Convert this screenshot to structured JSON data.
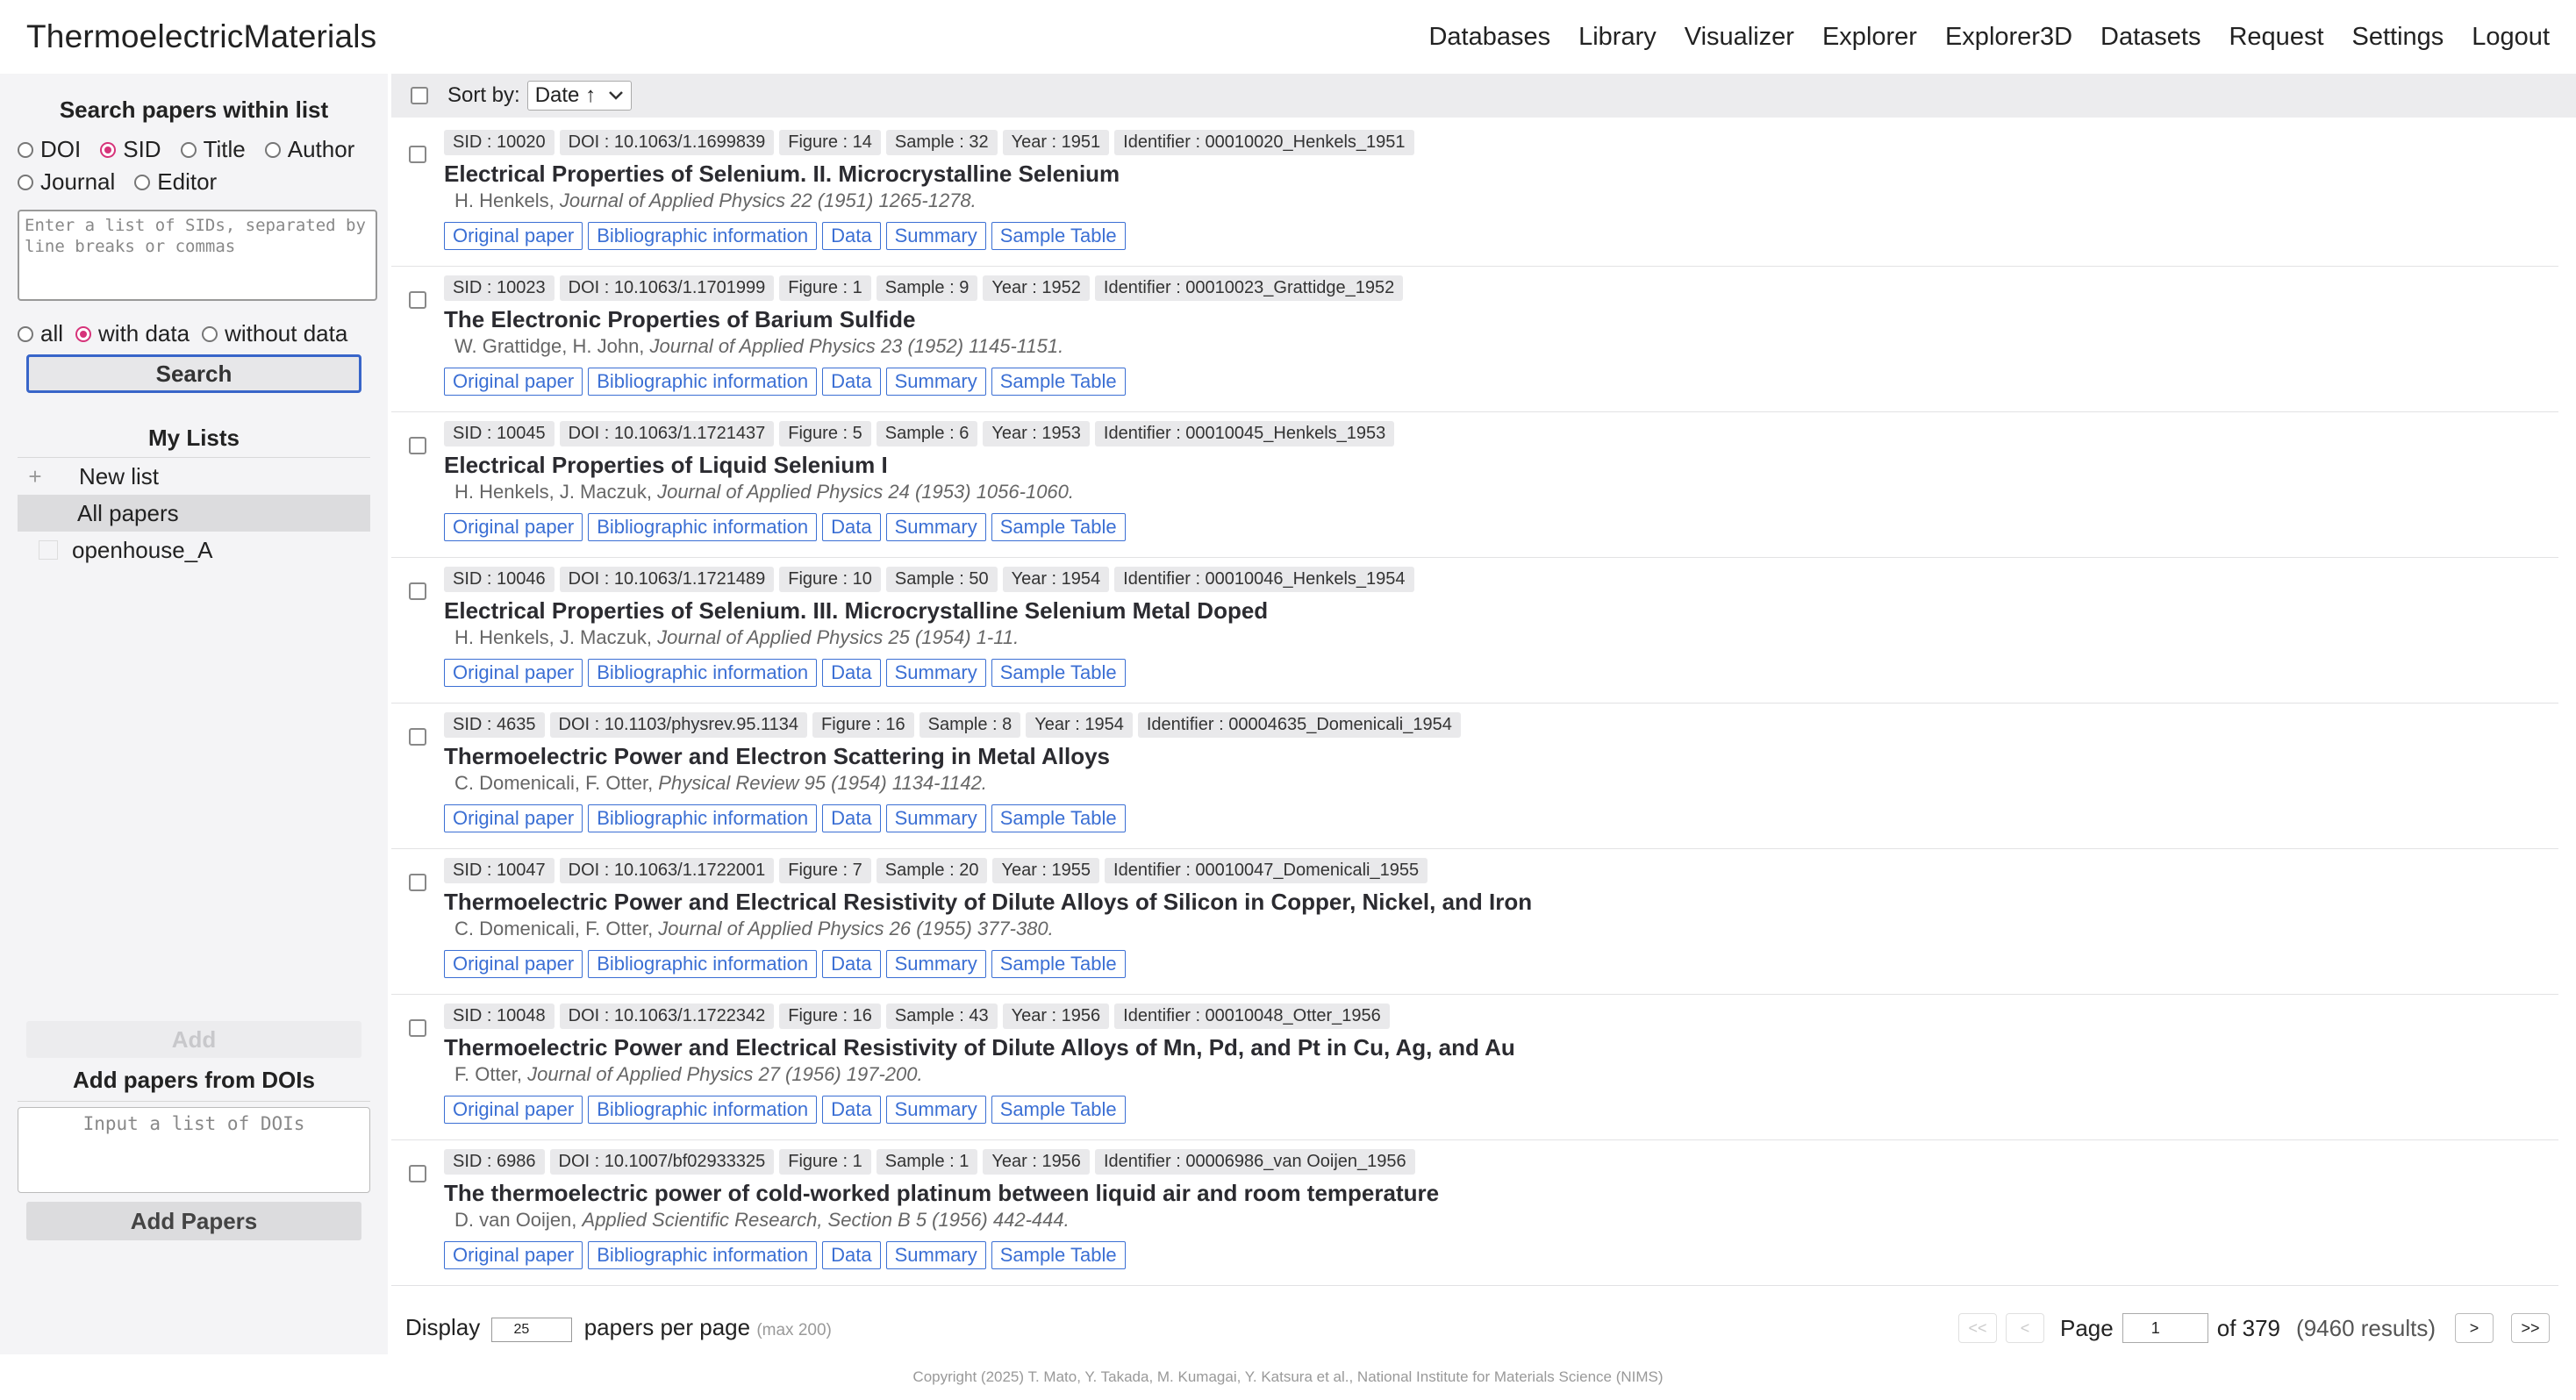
{
  "brand": "ThermoelectricMaterials",
  "nav": [
    "Databases",
    "Library",
    "Visualizer",
    "Explorer",
    "Explorer3D",
    "Datasets",
    "Request",
    "Settings",
    "Logout"
  ],
  "sidebar": {
    "search_heading": "Search papers within list",
    "search_by": [
      {
        "label": "DOI",
        "selected": false
      },
      {
        "label": "SID",
        "selected": true
      },
      {
        "label": "Title",
        "selected": false
      },
      {
        "label": "Author",
        "selected": false
      },
      {
        "label": "Journal",
        "selected": false
      },
      {
        "label": "Editor",
        "selected": false
      }
    ],
    "sid_placeholder": "Enter a list of SIDs, separated by line breaks or commas",
    "data_filter": [
      {
        "label": "all",
        "selected": false
      },
      {
        "label": "with data",
        "selected": true
      },
      {
        "label": "without data",
        "selected": false
      }
    ],
    "search_button": "Search",
    "my_lists_title": "My Lists",
    "new_list": "New list",
    "all_papers": "All papers",
    "lists": [
      "openhouse_A"
    ],
    "add_button": "Add",
    "add_dois_title": "Add papers from DOIs",
    "dois_placeholder": "Input a list of DOIs",
    "add_papers_button": "Add Papers"
  },
  "sortbar": {
    "label": "Sort by:",
    "value": "Date ↑"
  },
  "papers": [
    {
      "tags": [
        "SID : 10020",
        "DOI : 10.1063/1.1699839",
        "Figure : 14",
        "Sample : 32",
        "Year : 1951",
        "Identifier : 00010020_Henkels_1951"
      ],
      "title": "Electrical Properties of Selenium. II. Microcrystalline Selenium",
      "authors": "H. Henkels, ",
      "journal": "Journal of Applied Physics 22 (1951) 1265-1278."
    },
    {
      "tags": [
        "SID : 10023",
        "DOI : 10.1063/1.1701999",
        "Figure : 1",
        "Sample : 9",
        "Year : 1952",
        "Identifier : 00010023_Grattidge_1952"
      ],
      "title": "The Electronic Properties of Barium Sulfide",
      "authors": "W. Grattidge, H. John, ",
      "journal": "Journal of Applied Physics 23 (1952) 1145-1151."
    },
    {
      "tags": [
        "SID : 10045",
        "DOI : 10.1063/1.1721437",
        "Figure : 5",
        "Sample : 6",
        "Year : 1953",
        "Identifier : 00010045_Henkels_1953"
      ],
      "title": "Electrical Properties of Liquid Selenium I",
      "authors": "H. Henkels, J. Maczuk, ",
      "journal": "Journal of Applied Physics 24 (1953) 1056-1060."
    },
    {
      "tags": [
        "SID : 10046",
        "DOI : 10.1063/1.1721489",
        "Figure : 10",
        "Sample : 50",
        "Year : 1954",
        "Identifier : 00010046_Henkels_1954"
      ],
      "title": "Electrical Properties of Selenium. III. Microcrystalline Selenium Metal Doped",
      "authors": "H. Henkels, J. Maczuk, ",
      "journal": "Journal of Applied Physics 25 (1954) 1-11."
    },
    {
      "tags": [
        "SID : 4635",
        "DOI : 10.1103/physrev.95.1134",
        "Figure : 16",
        "Sample : 8",
        "Year : 1954",
        "Identifier : 00004635_Domenicali_1954"
      ],
      "title": "Thermoelectric Power and Electron Scattering in Metal Alloys",
      "authors": "C. Domenicali, F. Otter, ",
      "journal": "Physical Review 95 (1954) 1134-1142."
    },
    {
      "tags": [
        "SID : 10047",
        "DOI : 10.1063/1.1722001",
        "Figure : 7",
        "Sample : 20",
        "Year : 1955",
        "Identifier : 00010047_Domenicali_1955"
      ],
      "title": "Thermoelectric Power and Electrical Resistivity of Dilute Alloys of Silicon in Copper, Nickel, and Iron",
      "authors": "C. Domenicali, F. Otter, ",
      "journal": "Journal of Applied Physics 26 (1955) 377-380."
    },
    {
      "tags": [
        "SID : 10048",
        "DOI : 10.1063/1.1722342",
        "Figure : 16",
        "Sample : 43",
        "Year : 1956",
        "Identifier : 00010048_Otter_1956"
      ],
      "title": "Thermoelectric Power and Electrical Resistivity of Dilute Alloys of Mn, Pd, and Pt in Cu, Ag, and Au",
      "authors": "F. Otter, ",
      "journal": "Journal of Applied Physics 27 (1956) 197-200."
    },
    {
      "tags": [
        "SID : 6986",
        "DOI : 10.1007/bf02933325",
        "Figure : 1",
        "Sample : 1",
        "Year : 1956",
        "Identifier : 00006986_van Ooijen_1956"
      ],
      "title": "The thermoelectric power of cold-worked platinum between liquid air and room temperature",
      "authors": "D. van Ooijen, ",
      "journal": "Applied Scientific Research, Section B 5 (1956) 442-444."
    }
  ],
  "paper_buttons": [
    "Original paper",
    "Bibliographic information",
    "Data",
    "Summary",
    "Sample Table"
  ],
  "bottombar": {
    "display_label": "Display",
    "per_page": "25",
    "per_page_suffix": "papers per page",
    "max_note": "(max 200)",
    "first": "<<",
    "prev": "<",
    "page_label": "Page",
    "page_value": "1",
    "of_pages": "of 379",
    "results": "(9460 results)",
    "next": ">",
    "last": ">>"
  },
  "footer": "Copyright (2025) T. Mato, Y. Takada, M. Kumagai, Y. Katsura et al., National Institute for Materials Science (NIMS)"
}
